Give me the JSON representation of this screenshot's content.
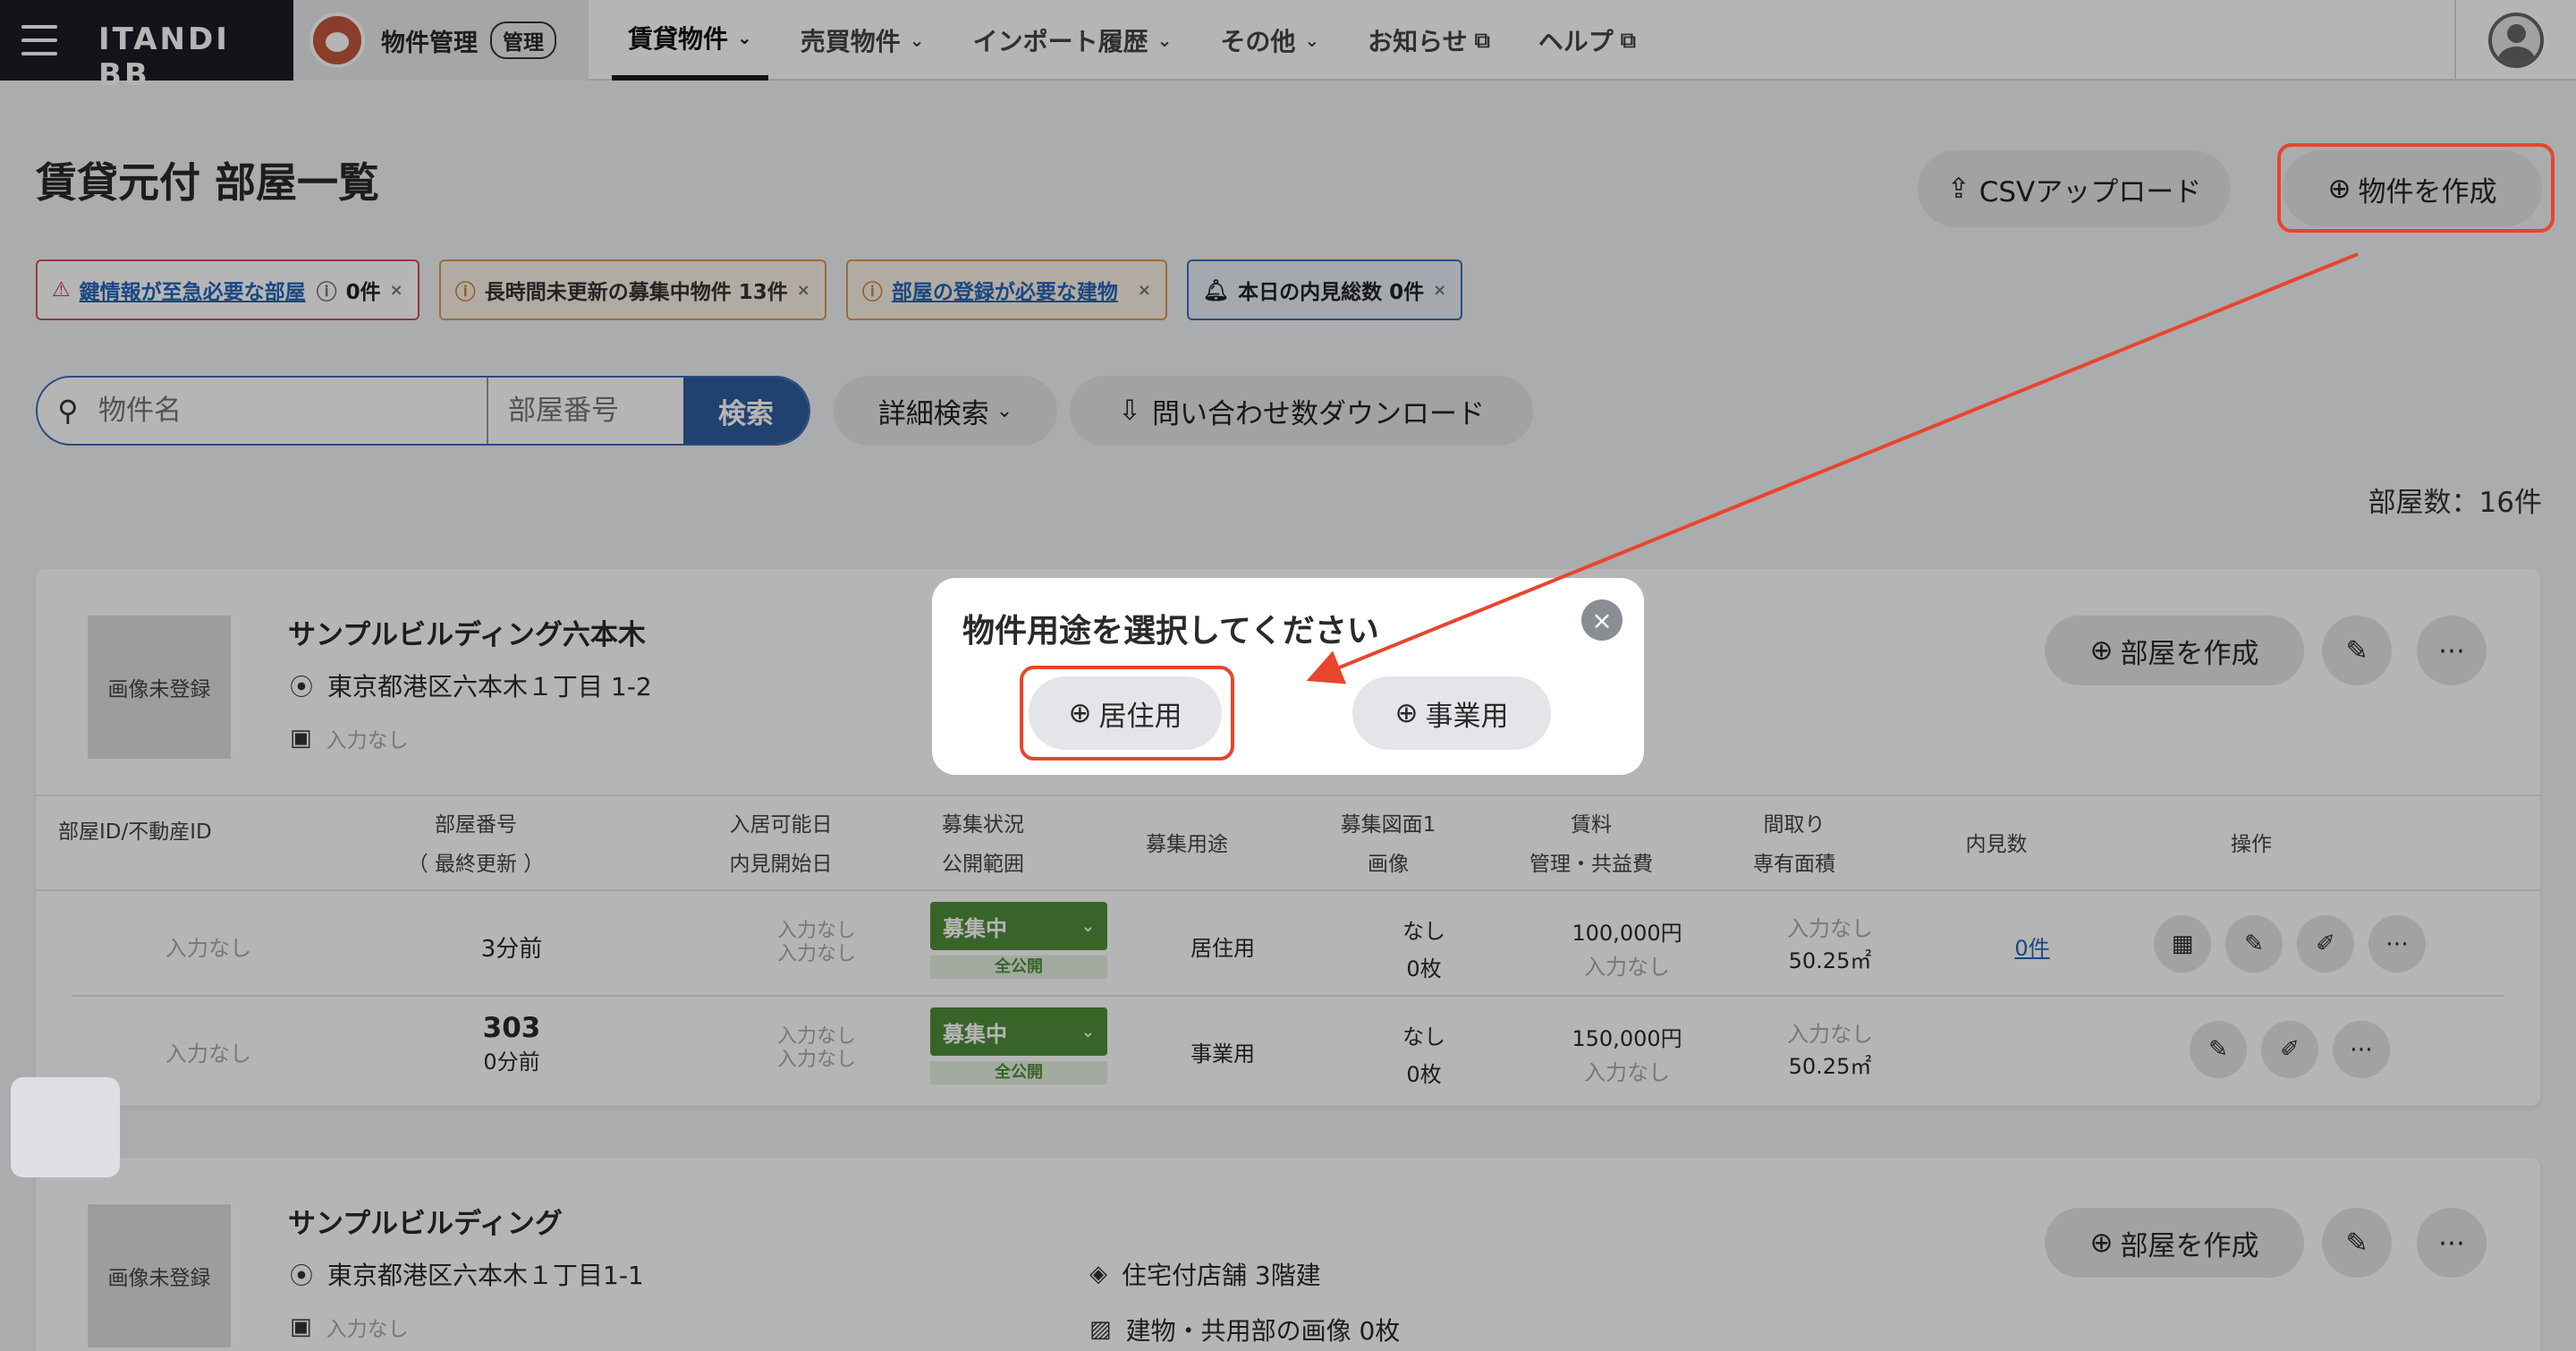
{
  "header": {
    "brand": "ITANDI BB",
    "app_name": "物件管理",
    "app_tag": "管理",
    "nav": [
      {
        "label": "賃貸物件",
        "chevron": true,
        "active": true
      },
      {
        "label": "売買物件",
        "chevron": true
      },
      {
        "label": "インポート履歴",
        "chevron": true
      },
      {
        "label": "その他",
        "chevron": true
      },
      {
        "label": "お知らせ",
        "external": true
      },
      {
        "label": "ヘルプ",
        "external": true
      }
    ]
  },
  "page": {
    "title": "賃貸元付 部屋一覧",
    "csv_upload": "CSVアップロード",
    "create_property": "物件を作成",
    "room_count": "部屋数：16件"
  },
  "alerts": [
    {
      "icon": "warning-icon",
      "link": "鍵情報が至急必要な部屋",
      "count": "0件"
    },
    {
      "icon": "clock-icon",
      "text": "長時間未更新の募集中物件 13件"
    },
    {
      "icon": "clock-icon",
      "link": "部屋の登録が必要な建物"
    },
    {
      "icon": "bell-icon",
      "text": "本日の内見総数 0件"
    }
  ],
  "search": {
    "name_placeholder": "物件名",
    "room_placeholder": "部屋番号",
    "search_button": "検索",
    "detail_button": "詳細検索",
    "download_button": "問い合わせ数ダウンロード"
  },
  "buildings": [
    {
      "thumb": "画像未登録",
      "name": "サンプルビルディング六本木",
      "address": "東京都港区六本木１丁目 1-2",
      "station": "入力なし",
      "create_room": "部屋を作成"
    },
    {
      "thumb": "画像未登録",
      "name": "サンプルビルディング",
      "address": "東京都港区六本木１丁目1-1",
      "station": "入力なし",
      "structure": "住宅付店舗 3階建",
      "images": "建物・共用部の画像 0枚",
      "create_room": "部屋を作成"
    }
  ],
  "table": {
    "headers": {
      "room_id": "部屋ID/不動産ID",
      "room_no": "部屋番号",
      "room_no_sub": "（ 最終更新 ）",
      "movein": "入居可能日",
      "movein_sub": "内見開始日",
      "status": "募集状況",
      "status_sub": "公開範囲",
      "usage": "募集用途",
      "plan": "募集図面1",
      "plan_sub": "画像",
      "rent": "賃料",
      "rent_sub": "管理・共益費",
      "layout": "間取り",
      "layout_sub": "専有面積",
      "views": "内見数",
      "ops": "操作"
    },
    "rows": [
      {
        "room_id": "入力なし",
        "room_no": "",
        "updated": "3分前",
        "movein": "入力なし",
        "viewing": "入力なし",
        "status": "募集中",
        "scope": "全公開",
        "usage": "居住用",
        "plan": "なし",
        "images": "0枚",
        "rent": "100,000円",
        "fee": "入力なし",
        "layout": "入力なし",
        "area": "50.25㎡",
        "views": "0件"
      },
      {
        "room_id": "入力なし",
        "room_no": "303",
        "updated": "0分前",
        "movein": "入力なし",
        "viewing": "入力なし",
        "status": "募集中",
        "scope": "全公開",
        "usage": "事業用",
        "plan": "なし",
        "images": "0枚",
        "rent": "150,000円",
        "fee": "入力なし",
        "layout": "入力なし",
        "area": "50.25㎡",
        "views": ""
      }
    ]
  },
  "modal": {
    "title": "物件用途を選択してください",
    "residential": "居住用",
    "business": "事業用"
  },
  "colors": {
    "annotation": "#e8452c",
    "status_green": "#4f8d3b",
    "search_blue": "#2f5c9c"
  }
}
